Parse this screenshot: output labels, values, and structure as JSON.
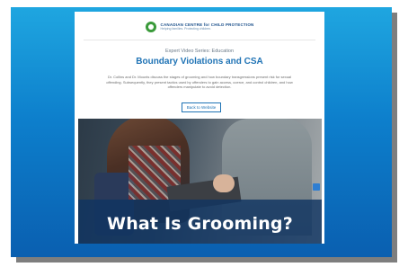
{
  "header": {
    "logo_main": "CANADIAN CENTRE for CHILD PROTECTION",
    "logo_sub": "Helping families. Protecting children."
  },
  "hero": {
    "eyebrow": "Expert Video Series: Education",
    "title": "Boundary Violations and CSA",
    "description": "Dr. Collins and Dr. Mounts discuss the stages of grooming and how boundary transgressions present risk for sexual offending. Subsequently, they present tactics used by offenders to gain access, coerce, and control children, and how offenders manipulate to avoid detection.",
    "back_button": "Back to Website"
  },
  "video": {
    "overlay_title": "What Is Grooming?"
  },
  "colors": {
    "frame_gradient_top": "#1fa6e0",
    "frame_gradient_bottom": "#0a5fb0",
    "accent": "#1f73b5",
    "overlay": "#103461"
  },
  "icons": {
    "logo": "ccp-logo-icon",
    "captions": "captions-icon"
  }
}
